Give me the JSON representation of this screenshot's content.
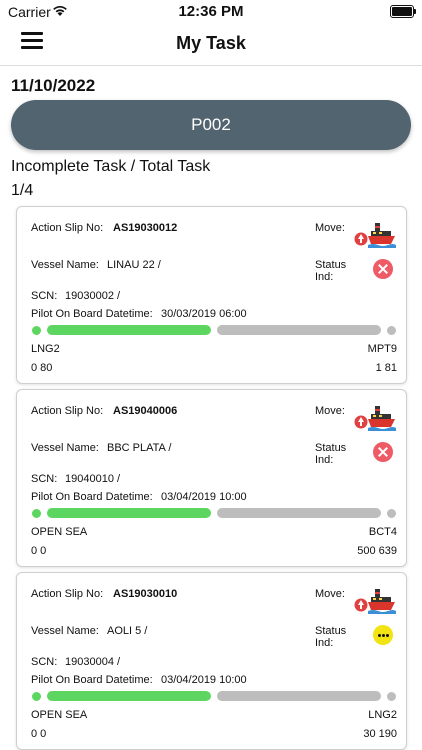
{
  "status_bar": {
    "carrier": "Carrier",
    "time": "12:36 PM"
  },
  "nav": {
    "title": "My Task"
  },
  "date": "11/10/2022",
  "pilot_code": "P002",
  "summary": {
    "label": "Incomplete Task / Total Task",
    "value": "1/4"
  },
  "labels": {
    "action_slip_no": "Action Slip No:",
    "move": "Move:",
    "vessel_name": "Vessel Name:",
    "status_ind_1": "Status",
    "status_ind_2": "Ind:",
    "scn": "SCN:",
    "pilot_on_board": "Pilot On Board Datetime:"
  },
  "tasks": [
    {
      "action_slip_no": "AS19030012",
      "vessel_name": "LINAU 22  /",
      "scn": "19030002  /",
      "pilot_on_board_datetime": "30/03/2019 06:00",
      "status_icon": "cancel-icon",
      "from_location": "LNG2",
      "to_location": "MPT9",
      "from_values": "0  80",
      "to_values": "1  81"
    },
    {
      "action_slip_no": "AS19040006",
      "vessel_name": "BBC PLATA  /",
      "scn": "19040010  /",
      "pilot_on_board_datetime": "03/04/2019 10:00",
      "status_icon": "cancel-icon",
      "from_location": "OPEN SEA",
      "to_location": "BCT4",
      "from_values": "0  0",
      "to_values": "500  639"
    },
    {
      "action_slip_no": "AS19030010",
      "vessel_name": "AOLI 5  /",
      "scn": "19030004  /",
      "pilot_on_board_datetime": "03/04/2019 10:00",
      "status_icon": "pending-icon",
      "from_location": "OPEN SEA",
      "to_location": "LNG2",
      "from_values": "0  0",
      "to_values": "30  190"
    }
  ]
}
